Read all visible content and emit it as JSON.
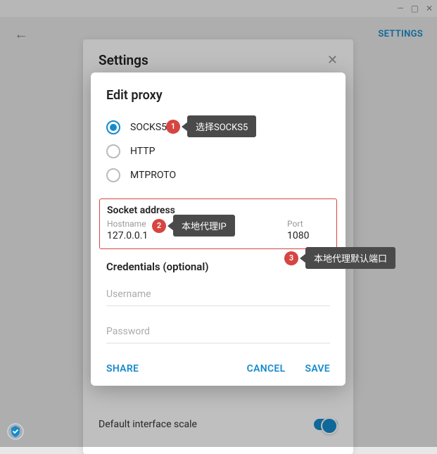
{
  "window": {
    "minimize": "—",
    "maximize": "▢",
    "close": "✕"
  },
  "header": {
    "back": "←",
    "settings_link": "SETTINGS"
  },
  "settings_panel": {
    "title": "Settings",
    "close": "✕",
    "interface_scale": "Default interface scale"
  },
  "modal": {
    "title": "Edit proxy",
    "proxy_types": {
      "socks5": "SOCKS5",
      "http": "HTTP",
      "mtproto": "MTPROTO"
    },
    "socket": {
      "section": "Socket address",
      "hostname_label": "Hostname",
      "hostname_value": "127.0.0.1",
      "port_label": "Port",
      "port_value": "1080"
    },
    "credentials": {
      "section": "Credentials (optional)",
      "username_placeholder": "Username",
      "password_placeholder": "Password"
    },
    "buttons": {
      "share": "SHARE",
      "cancel": "CANCEL",
      "save": "SAVE"
    }
  },
  "callouts": {
    "one": {
      "num": "1",
      "text": "选择SOCKS5"
    },
    "two": {
      "num": "2",
      "text": "本地代理IP"
    },
    "three": {
      "num": "3",
      "text": "本地代理默认端口"
    }
  }
}
